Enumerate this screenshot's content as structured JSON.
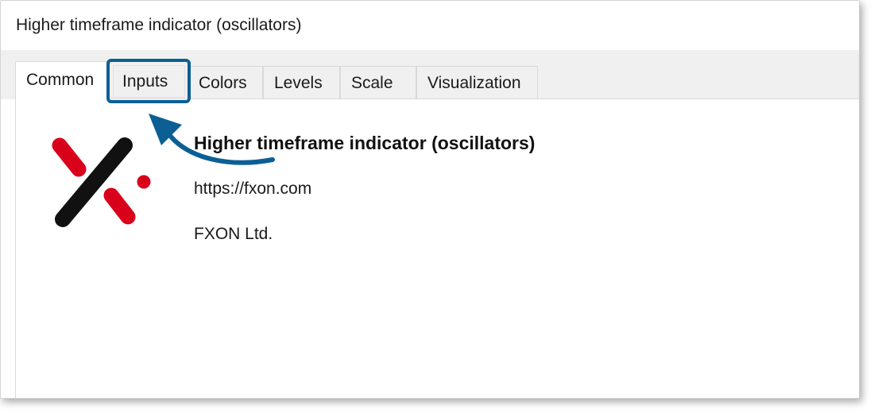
{
  "window": {
    "title": "Higher timeframe indicator (oscillators)"
  },
  "tabs": [
    {
      "label": "Common",
      "active": true
    },
    {
      "label": "Inputs",
      "active": false,
      "highlighted": true
    },
    {
      "label": "Colors",
      "active": false
    },
    {
      "label": "Levels",
      "active": false
    },
    {
      "label": "Scale",
      "active": false
    },
    {
      "label": "Visualization",
      "active": false
    }
  ],
  "info": {
    "name": "Higher timeframe indicator (oscillators)",
    "url": "https://fxon.com",
    "company": "FXON Ltd."
  },
  "logo": {
    "icon": "fxon-logo-icon",
    "colors": {
      "dark": "#111111",
      "red": "#d9001b"
    }
  },
  "annotation": {
    "highlight_color": "#0b5f95",
    "arrow_icon": "curved-arrow-icon"
  }
}
